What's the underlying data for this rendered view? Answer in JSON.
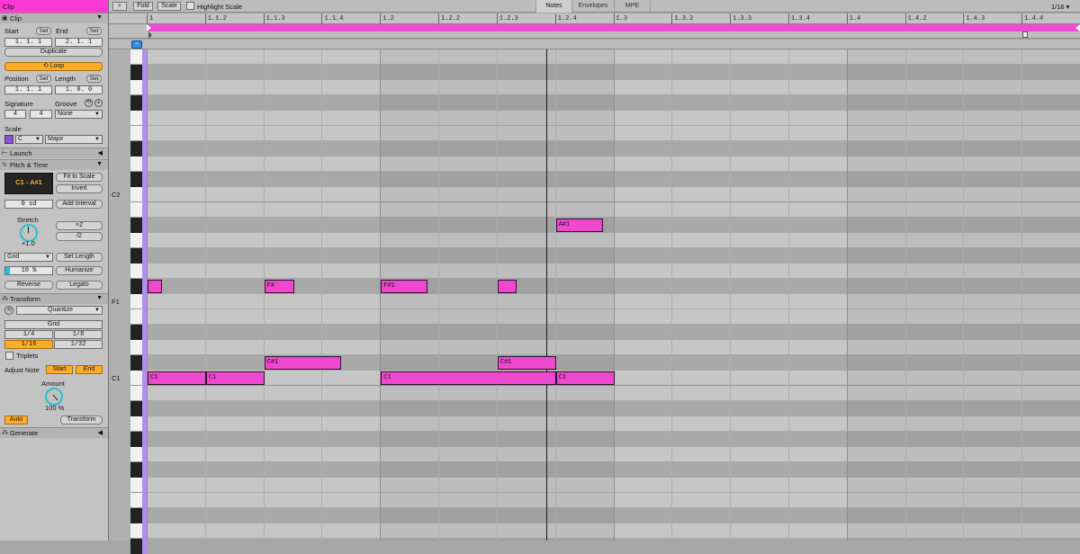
{
  "panel": {
    "header_title": "Clip",
    "clip_section": {
      "title": "Clip",
      "start_label": "Start",
      "set1": "Set",
      "end_label": "End",
      "set2": "Set",
      "start_value": "1.  1.  1",
      "end_value": "2.  1.  1",
      "duplicate": "Duplicate",
      "loop": "Loop",
      "position_label": "Position",
      "set3": "Set",
      "length_label": "Length",
      "set4": "Set",
      "position_value": "1.  1.  1",
      "length_value": "1.  0.  0",
      "signature_label": "Signature",
      "groove_label": "Groove",
      "sig_num": "4",
      "sig_den": "4",
      "groove_value": "None",
      "scale_label": "Scale",
      "scale_root": "C",
      "scale_mode": "Major"
    },
    "launch_title": "Launch",
    "pitch_time": {
      "title": "Pitch & Time",
      "range": "C1 - A#1",
      "fit_to_scale": "Fit to Scale",
      "invert": "Invert",
      "semitones": "0 sd",
      "add_interval": "Add Interval",
      "stretch_label": "Stretch",
      "stretch_value": "×1.0",
      "times2": "×2",
      "div2": "/2",
      "grid_select": "Grid",
      "set_length": "Set Length",
      "percent": "10 %",
      "percent_value": 0.1,
      "humanize": "Humanize",
      "reverse": "Reverse",
      "legato": "Legato"
    },
    "transform": {
      "title": "Transform",
      "quantize": "Quantize",
      "grid_label": "Grid",
      "q1_4": "1/4",
      "q1_8": "1/8",
      "q1_16": "1/16",
      "q1_32": "1/32",
      "triplets": "Triplets",
      "adjust_note": "Adjust Note",
      "start": "Start",
      "end": "End",
      "amount_label": "Amount",
      "amount_value": "100 %",
      "auto": "Auto",
      "transform_btn": "Transform"
    },
    "generate_title": "Generate"
  },
  "topbar": {
    "fold": "Fold",
    "scale": "Scale",
    "highlight_scale": "Highlight Scale",
    "tab_notes": "Notes",
    "tab_envelopes": "Envelopes",
    "tab_mpe": "MPE",
    "grid_value": "1/16 ▾"
  },
  "ruler": {
    "ticks": [
      "1",
      "1.1.2",
      "1.1.3",
      "1.1.4",
      "1.2",
      "1.2.2",
      "1.2.3",
      "1.2.4",
      "1.3",
      "1.3.2",
      "1.3.3",
      "1.3.4",
      "1.4",
      "1.4.2",
      "1.4.3",
      "1.4.4"
    ]
  },
  "key_labels": [
    "C2",
    "F1",
    "C1"
  ],
  "piano_roll": {
    "beats_total": 4,
    "notes": [
      {
        "pitch": "C1",
        "start": 0.0,
        "length": 0.25,
        "label": "C1"
      },
      {
        "pitch": "C1",
        "start": 1.0,
        "length": 0.25,
        "label": "C1"
      },
      {
        "pitch": "C1",
        "start": 4.0,
        "length": 0.75,
        "label": "C1"
      },
      {
        "pitch": "C1",
        "start": 7.0,
        "length": 0.25,
        "label": "C1"
      },
      {
        "pitch": "C#1",
        "start": 2.0,
        "length": 0.33,
        "label": "C#1"
      },
      {
        "pitch": "C#1",
        "start": 6.0,
        "length": 0.25,
        "label": "C#1"
      },
      {
        "pitch": "F#1",
        "start": 0.0,
        "length": 0.06,
        "label": ""
      },
      {
        "pitch": "F#1",
        "start": 2.0,
        "length": 0.13,
        "label": "F#"
      },
      {
        "pitch": "F#1",
        "start": 4.0,
        "length": 0.2,
        "label": "F#1"
      },
      {
        "pitch": "F#1",
        "start": 6.0,
        "length": 0.08,
        "label": ""
      },
      {
        "pitch": "A#1",
        "start": 7.0,
        "length": 0.2,
        "label": "A#1"
      }
    ]
  },
  "colors": {
    "note": "#ee48cf",
    "accent_orange": "#ffad28",
    "loop_bar": "#ef4ad4",
    "clip_header": "#ff39d4"
  }
}
